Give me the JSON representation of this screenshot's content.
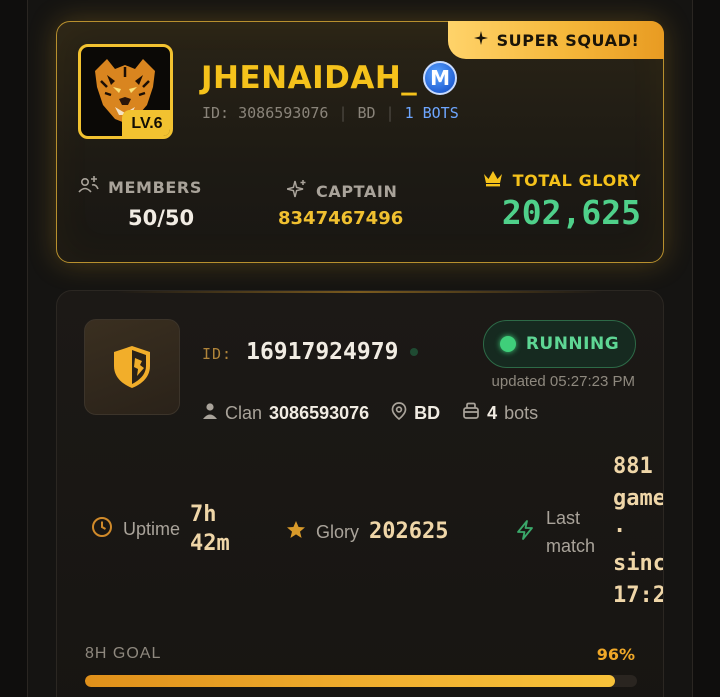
{
  "squad": {
    "badge": "SUPER SQUAD!",
    "level": "LV.6",
    "name": "JHENAIDAH_",
    "verified_mark": "M",
    "id_text": "ID: 3086593076",
    "region": "BD",
    "bots": "1 BOTS",
    "members_label": "MEMBERS",
    "members_value": "50/50",
    "captain_label": "CAPTAIN",
    "captain_value": "8347467496",
    "glory_label": "TOTAL GLORY",
    "glory_value": "202,625"
  },
  "bot": {
    "id_label": "ID:",
    "id_value": "16917924979",
    "status": "RUNNING",
    "updated": "updated 05:27:23 PM",
    "clan_label": "Clan",
    "clan_value": "3086593076",
    "region": "BD",
    "bots_count": "4",
    "bots_label": "bots",
    "uptime_label": "Uptime",
    "uptime_value_1": "7h",
    "uptime_value_2": "42m",
    "glory_label": "Glory",
    "glory_value": "202625",
    "last_match_label_1": "Last",
    "last_match_label_2": "match",
    "games_line_1": "881",
    "games_line_2": "games",
    "games_line_3": "·",
    "games_line_4": "since",
    "games_line_5": "17:2",
    "goal_label": "8H GOAL",
    "goal_pct": "96%",
    "goal_progress": 0.96
  },
  "colors": {
    "gold": "#f5c21b",
    "green": "#4fd08a",
    "blue": "#6ea6ff",
    "amber": "#f0a828"
  },
  "icons": [
    "star-icon",
    "members-icon",
    "captain-sparkle-icon",
    "crown-icon",
    "shield-icon",
    "person-icon",
    "location-pin-icon",
    "bots-box-icon",
    "clock-icon",
    "glory-star-icon",
    "lightning-icon"
  ]
}
